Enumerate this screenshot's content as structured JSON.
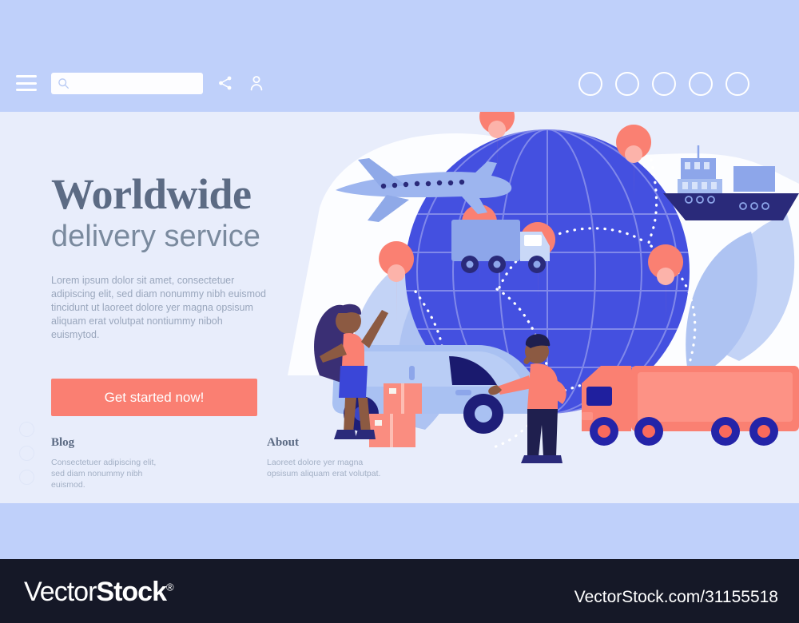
{
  "colors": {
    "header_band": "#bfd0fa",
    "page_bg": "#e8edfb",
    "accent_coral": "#fa7f72",
    "globe_blue": "#4450e0",
    "heading": "#5c6b84",
    "footer_bg": "#151827"
  },
  "header": {
    "menu_icon": "hamburger-menu-icon",
    "search": {
      "icon": "search-icon",
      "value": "",
      "placeholder": ""
    },
    "share_icon": "share-icon",
    "user_icon": "user-account-icon",
    "nav_circles": [
      "",
      "",
      "",
      "",
      ""
    ]
  },
  "hero": {
    "title": "Worldwide",
    "subtitle": "delivery service",
    "paragraph": "Lorem ipsum dolor sit amet, consectetuer adipiscing elit, sed diam nonummy nibh euismod tincidunt ut laoreet dolore yer magna opsisum aliquam erat volutpat nontiummy niboh euismytod.",
    "cta_label": "Get started now!"
  },
  "footer_links": [
    {
      "heading": "Blog",
      "text": "Consectetuer adipiscing elit, sed diam nonummy nibh euismod."
    },
    {
      "heading": "About",
      "text": "Laoreet dolore yer magna opsisum aliquam erat volutpat."
    }
  ],
  "illustration": {
    "description": "globe-with-delivery-routes",
    "elements": [
      "globe",
      "airplane",
      "cargo-ship",
      "blue-box-truck",
      "coral-semi-truck",
      "delivery-van",
      "woman-character",
      "man-character",
      "cardboard-boxes",
      "map-pins",
      "dotted-routes"
    ],
    "map_pin_count": 6
  },
  "watermark": {
    "logo_thin": "Vector",
    "logo_bold": "Stock",
    "logo_mark": "®",
    "url": "VectorStock.com/31155518"
  }
}
